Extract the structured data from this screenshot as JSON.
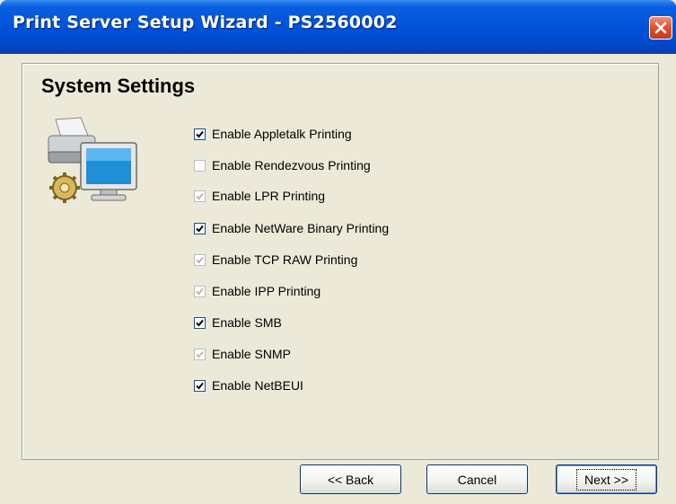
{
  "window": {
    "title": "Print Server Setup Wizard - PS2560002"
  },
  "panel": {
    "title": "System Settings"
  },
  "options": [
    {
      "label": "Enable Appletalk Printing",
      "checked": true,
      "enabled": true
    },
    {
      "label": "Enable Rendezvous Printing",
      "checked": false,
      "enabled": false
    },
    {
      "label": "Enable LPR Printing",
      "checked": true,
      "enabled": false
    },
    {
      "label": "Enable NetWare Binary Printing",
      "checked": true,
      "enabled": true
    },
    {
      "label": "Enable TCP RAW Printing",
      "checked": true,
      "enabled": false
    },
    {
      "label": "Enable IPP Printing",
      "checked": true,
      "enabled": false
    },
    {
      "label": "Enable SMB",
      "checked": true,
      "enabled": true
    },
    {
      "label": "Enable SNMP",
      "checked": true,
      "enabled": false
    },
    {
      "label": "Enable NetBEUI",
      "checked": true,
      "enabled": true
    }
  ],
  "buttons": {
    "back": "<< Back",
    "cancel": "Cancel",
    "next": "Next >>"
  },
  "icons": {
    "close": "close-icon",
    "hero": "printer-computer-icon",
    "check": "checkmark-icon"
  },
  "colors": {
    "titlebar": "#0052d8",
    "dialog_bg": "#ece9d8",
    "close_button": "#e0502c"
  }
}
